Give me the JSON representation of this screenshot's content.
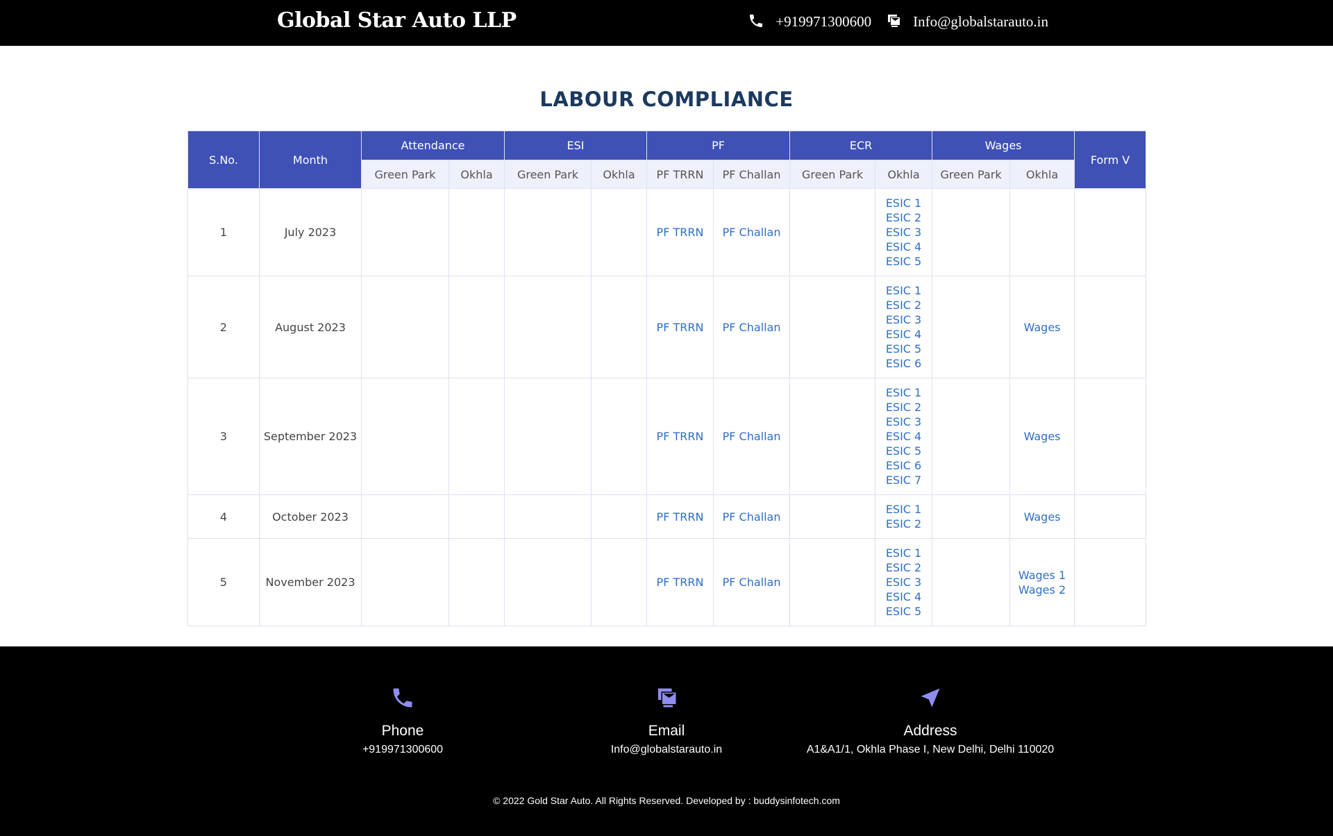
{
  "header": {
    "brand": "Global Star Auto LLP",
    "phone": "+919971300600",
    "email": "Info@globalstarauto.in"
  },
  "title": "LABOUR COMPLIANCE",
  "table": {
    "headers": {
      "sno": "S.No.",
      "month": "Month",
      "attendance": "Attendance",
      "esi": "ESI",
      "pf": "PF",
      "ecr": "ECR",
      "wages": "Wages",
      "formv": "Form V"
    },
    "subheaders": [
      "Green Park",
      "Okhla",
      "Green Park",
      "Okhla",
      "PF TRRN",
      "PF Challan",
      "Green Park",
      "Okhla",
      "Green Park",
      "Okhla"
    ],
    "rows": [
      {
        "sno": "1",
        "month": "July 2023",
        "pf_trrn": "PF TRRN",
        "pf_challan": "PF Challan",
        "ecr_okhla": [
          "ESIC 1",
          "ESIC 2",
          "ESIC 3",
          "ESIC 4",
          "ESIC 5"
        ],
        "wages_okhla": []
      },
      {
        "sno": "2",
        "month": "August 2023",
        "pf_trrn": "PF TRRN",
        "pf_challan": "PF Challan",
        "ecr_okhla": [
          "ESIC 1",
          "ESIC 2",
          "ESIC 3",
          "ESIC 4",
          "ESIC 5",
          "ESIC 6"
        ],
        "wages_okhla": [
          "Wages"
        ]
      },
      {
        "sno": "3",
        "month": "September 2023",
        "pf_trrn": "PF TRRN",
        "pf_challan": "PF Challan",
        "ecr_okhla": [
          "ESIC 1",
          "ESIC 2",
          "ESIC 3",
          "ESIC 4",
          "ESIC 5",
          "ESIC 6",
          "ESIC 7"
        ],
        "wages_okhla": [
          "Wages"
        ]
      },
      {
        "sno": "4",
        "month": "October 2023",
        "pf_trrn": "PF TRRN",
        "pf_challan": "PF Challan",
        "ecr_okhla": [
          "ESIC 1",
          "ESIC 2"
        ],
        "wages_okhla": [
          "Wages"
        ]
      },
      {
        "sno": "5",
        "month": "November 2023",
        "pf_trrn": "PF TRRN",
        "pf_challan": "PF Challan",
        "ecr_okhla": [
          "ESIC 1",
          "ESIC 2",
          "ESIC 3",
          "ESIC 4",
          "ESIC 5"
        ],
        "wages_okhla": [
          "Wages 1",
          "Wages 2"
        ]
      }
    ]
  },
  "footer": {
    "phone_label": "Phone",
    "phone_value": "+919971300600",
    "email_label": "Email",
    "email_value": "Info@globalstarauto.in",
    "address_label": "Address",
    "address_value": "A1&A1/1, Okhla Phase I, New Delhi, Delhi 110020",
    "copyright": "© 2022 Gold Star Auto. All Rights Reserved. Developed by : buddysinfotech.com",
    "icon_color": "#8f8cf2"
  },
  "colors": {
    "header_bg": "#000000",
    "table_header": "#3f51b5",
    "subheader_bg": "#eef0fb",
    "link": "#2f6fc4",
    "title": "#1c3960"
  }
}
